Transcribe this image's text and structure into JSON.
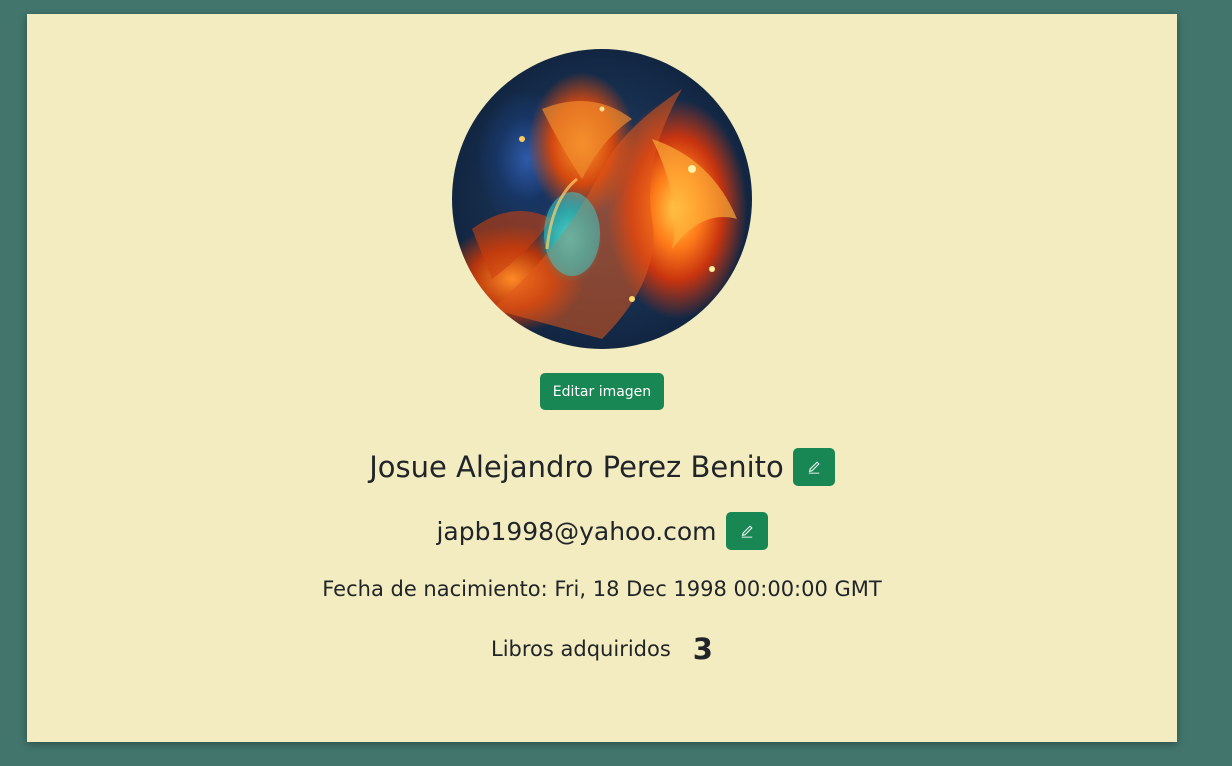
{
  "profile": {
    "edit_image_label": "Editar imagen",
    "name": "Josue Alejandro Perez Benito",
    "email": "japb1998@yahoo.com",
    "birth_date": "Fecha de nacimiento: Fri, 18 Dec 1998 00:00:00 GMT",
    "books_label": "Libros adquiridos",
    "books_count": "3"
  },
  "icons": {
    "edit_name": "pencil-icon",
    "edit_email": "pencil-icon"
  },
  "colors": {
    "background": "#42766d",
    "card": "#f3ecc0",
    "accent": "#198754",
    "text": "#212529"
  }
}
